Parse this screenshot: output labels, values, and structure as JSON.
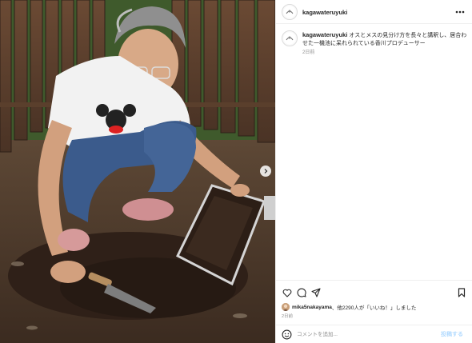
{
  "post": {
    "username": "kagawateruyuki",
    "more_icon": "more-horizontal-icon",
    "caption": {
      "username": "kagawateruyuki",
      "text": "オスとメスの見分け方を長々と講釈し、居合わせた一機池に呆れられている香川プロデューサー",
      "timestamp": "2日前"
    },
    "actions": {
      "like_icon": "heart-icon",
      "comment_icon": "comment-icon",
      "share_icon": "paper-plane-icon",
      "save_icon": "bookmark-icon"
    },
    "likes": {
      "username": "mika5nakayama",
      "text": "、他2290人が「いいね！」しました"
    },
    "date": "2日前",
    "comment": {
      "placeholder": "コメントを追加...",
      "post_label": "投稿する",
      "emoji_icon": "emoji-icon"
    },
    "media": {
      "next_icon": "chevron-right-icon"
    }
  }
}
